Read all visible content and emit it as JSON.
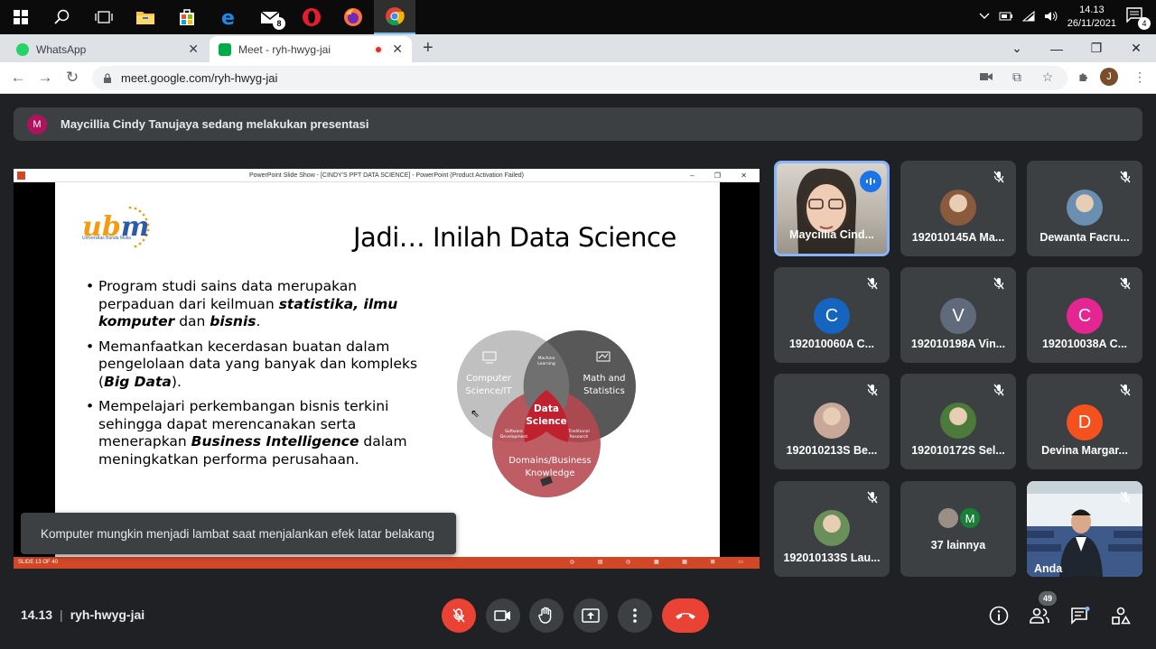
{
  "taskbar": {
    "apps": [
      {
        "icon": "windows-start-icon"
      },
      {
        "icon": "search-icon"
      },
      {
        "icon": "task-view-icon"
      },
      {
        "icon": "file-explorer-icon"
      },
      {
        "icon": "store-icon"
      },
      {
        "icon": "edge-icon"
      },
      {
        "icon": "mail-icon",
        "badge": "8"
      },
      {
        "icon": "opera-icon"
      },
      {
        "icon": "firefox-icon"
      },
      {
        "icon": "chrome-icon"
      }
    ],
    "time": "14.13",
    "date": "26/11/2021",
    "notifications": "4"
  },
  "browser": {
    "tabs": [
      {
        "title": "WhatsApp",
        "active": false
      },
      {
        "title": "Meet - ryh-hwyg-jai",
        "active": true
      }
    ],
    "url": "meet.google.com/ryh-hwyg-jai",
    "profile_initial": "J"
  },
  "meet": {
    "presenter_initial": "M",
    "presenting_text": "Maycillia Cindy Tanujaya sedang melakukan presentasi",
    "toast": "Komputer mungkin menjadi lambat saat menjalankan efek latar belakang",
    "meeting_time": "14.13",
    "meeting_code": "ryh-hwyg-jai",
    "participant_count": "49",
    "participants": [
      {
        "name": "Maycillia Cind...",
        "type": "video",
        "speaking": true
      },
      {
        "name": "192010145A Ma...",
        "type": "photo",
        "color": "#8a5a3c"
      },
      {
        "name": "Dewanta Facru...",
        "type": "photo",
        "color": "#6a8fb0"
      },
      {
        "name": "192010060A C...",
        "initial": "C",
        "color": "#1565c0"
      },
      {
        "name": "192010198A Vin...",
        "initial": "V",
        "color": "#5f6b7a"
      },
      {
        "name": "192010038A C...",
        "initial": "C",
        "color": "#e52592"
      },
      {
        "name": "192010213S Be...",
        "type": "photo",
        "color": "#c9a89a"
      },
      {
        "name": "192010172S Sel...",
        "type": "photo",
        "color": "#4b7a3a"
      },
      {
        "name": "Devina Margar...",
        "initial": "D",
        "color": "#f4511e"
      },
      {
        "name": "192010133S Lau...",
        "type": "photo",
        "color": "#6b8f5a"
      },
      {
        "name": "37 lainnya",
        "type": "others",
        "initial": "M"
      },
      {
        "name": "Anda",
        "type": "video-self"
      }
    ]
  },
  "presentation": {
    "window_title": "PowerPoint Slide Show - [CINDY'S PPT DATA SCIENCE] - PowerPoint (Product Activation Failed)",
    "status_text": "SLIDE 13 OF 40",
    "slide": {
      "logo_text_u": "u",
      "logo_text_b": "b",
      "logo_text_m": "m",
      "logo_sub": "Universitas Bunda Mulia",
      "title": "Jadi… Inilah Data Science",
      "bullet1_a": "Program studi sains data merupakan perpaduan dari keilmuan ",
      "bullet1_b": "statistika, ilmu komputer",
      "bullet1_c": " dan ",
      "bullet1_d": "bisnis",
      "bullet1_e": ".",
      "bullet2_a": "Memanfaatkan kecerdasan buatan dalam pengelolaan data yang banyak dan kompleks (",
      "bullet2_b": "Big Data",
      "bullet2_c": ").",
      "bullet3_a": "Mempelajari perkembangan bisnis terkini sehingga dapat merencanakan serta menerapkan ",
      "bullet3_b": "Business Intelligence",
      "bullet3_c": " dalam meningkatkan performa perusahaan.",
      "venn": {
        "cs": [
          "Computer",
          "Science/IT"
        ],
        "math": [
          "Math and",
          "Statistics"
        ],
        "domain": [
          "Domains/Business",
          "Knowledge"
        ],
        "center": [
          "Data",
          "Science"
        ],
        "ml": [
          "Machine",
          "Learning"
        ],
        "sd": [
          "Software",
          "Development"
        ],
        "tr": [
          "Traditional",
          "Research"
        ]
      }
    }
  }
}
